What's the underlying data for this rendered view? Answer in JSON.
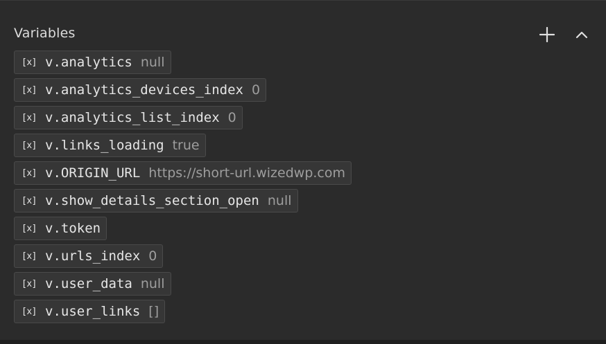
{
  "panel": {
    "title": "Variables",
    "add_icon": "plus-icon",
    "collapse_icon": "chevron-up-icon"
  },
  "variable_icon": "[x]",
  "variables": [
    {
      "name": "v.analytics",
      "value": "null"
    },
    {
      "name": "v.analytics_devices_index",
      "value": "0"
    },
    {
      "name": "v.analytics_list_index",
      "value": "0"
    },
    {
      "name": "v.links_loading",
      "value": "true"
    },
    {
      "name": "v.ORIGIN_URL",
      "value": "https://short-url.wizedwp.com"
    },
    {
      "name": "v.show_details_section_open",
      "value": "null"
    },
    {
      "name": "v.token",
      "value": ""
    },
    {
      "name": "v.urls_index",
      "value": "0"
    },
    {
      "name": "v.user_data",
      "value": "null"
    },
    {
      "name": "v.user_links",
      "value": "[]"
    }
  ],
  "colors": {
    "background": "#2b2b2b",
    "chip_background": "#363636",
    "chip_border": "#4a4a4a",
    "name_text": "#e6e6e6",
    "value_text": "#9e9e9e"
  }
}
